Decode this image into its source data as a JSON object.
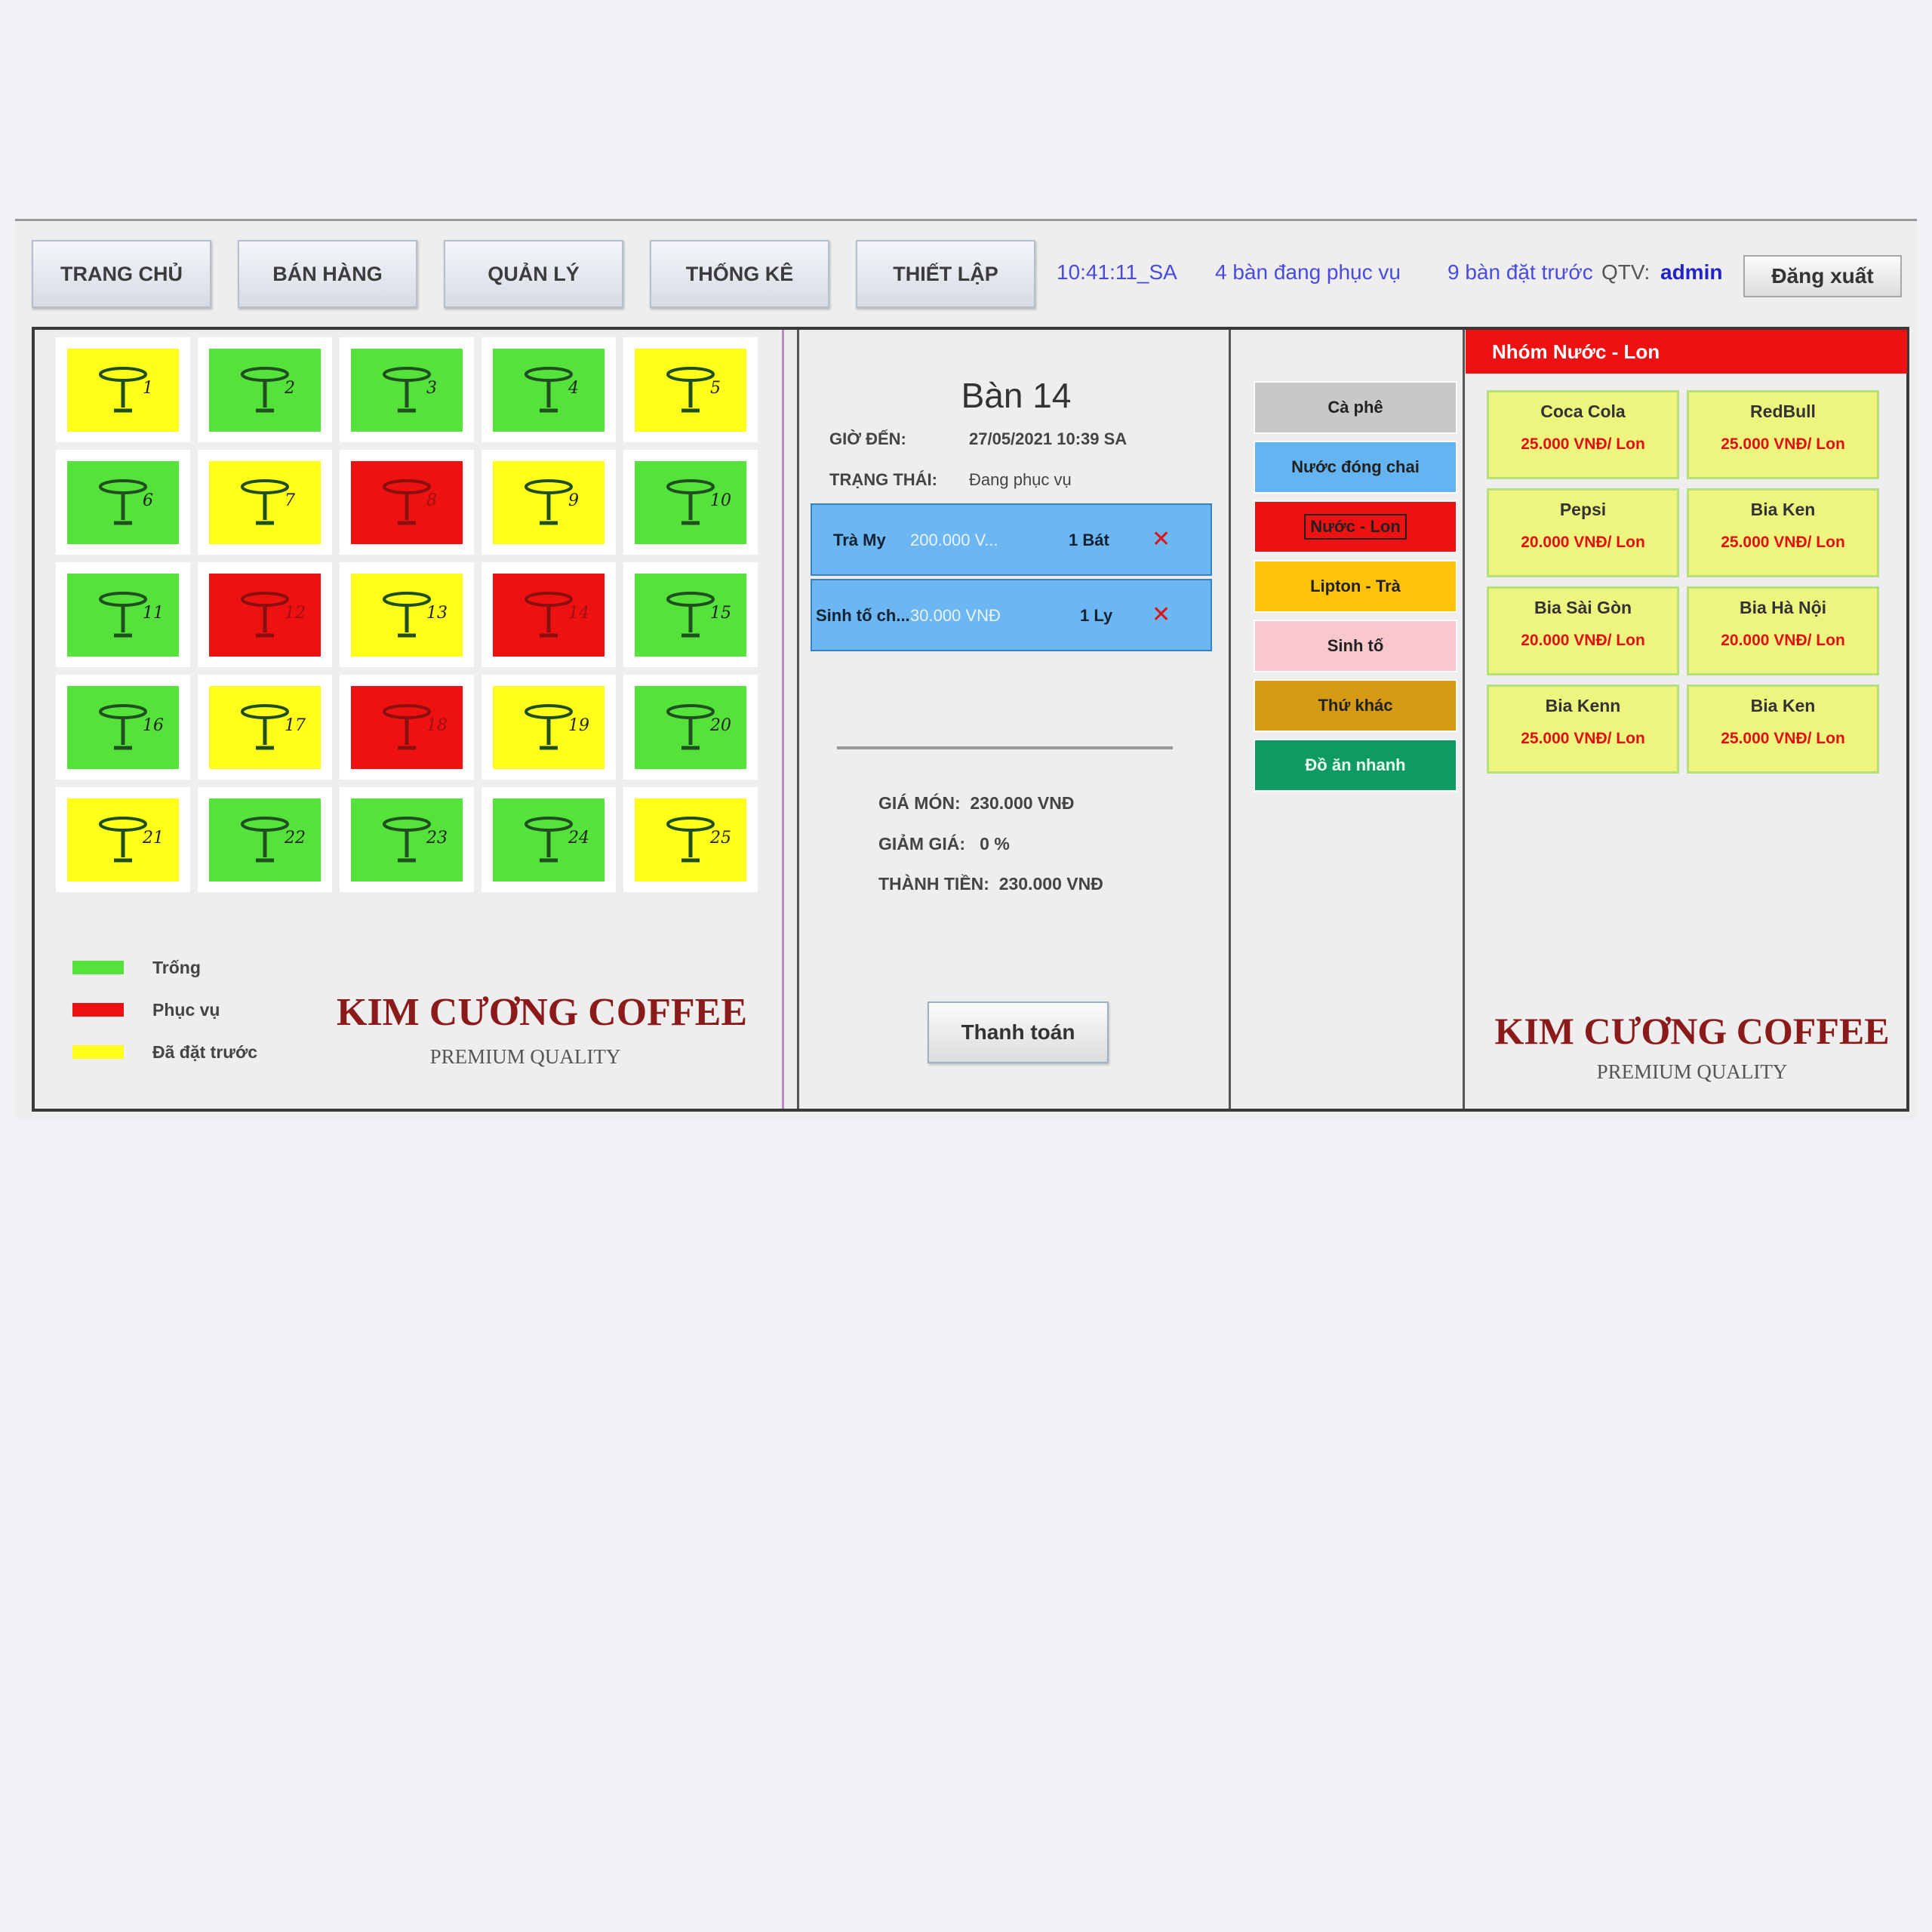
{
  "nav": [
    "TRANG CHỦ",
    "BÁN HÀNG",
    "QUẢN LÝ",
    "THỐNG KÊ",
    "THIẾT LẬP"
  ],
  "status": {
    "time": "10:41:11_SA",
    "serving": "4 bàn đang phục vụ",
    "reserved": "9 bàn đặt trước",
    "admin_label": "QTV:",
    "admin_name": "admin",
    "logout": "Đăng xuất"
  },
  "colors": {
    "empty": "#55e23b",
    "serving": "#ee1111",
    "reserved": "#ffff1a"
  },
  "tables": [
    {
      "num": "1",
      "state": "reserved"
    },
    {
      "num": "2",
      "state": "empty"
    },
    {
      "num": "3",
      "state": "empty"
    },
    {
      "num": "4",
      "state": "empty"
    },
    {
      "num": "5",
      "state": "reserved"
    },
    {
      "num": "6",
      "state": "empty"
    },
    {
      "num": "7",
      "state": "reserved"
    },
    {
      "num": "8",
      "state": "serving"
    },
    {
      "num": "9",
      "state": "reserved"
    },
    {
      "num": "10",
      "state": "empty"
    },
    {
      "num": "11",
      "state": "empty"
    },
    {
      "num": "12",
      "state": "serving"
    },
    {
      "num": "13",
      "state": "reserved"
    },
    {
      "num": "14",
      "state": "serving"
    },
    {
      "num": "15",
      "state": "empty"
    },
    {
      "num": "16",
      "state": "empty"
    },
    {
      "num": "17",
      "state": "reserved"
    },
    {
      "num": "18",
      "state": "serving"
    },
    {
      "num": "19",
      "state": "reserved"
    },
    {
      "num": "20",
      "state": "empty"
    },
    {
      "num": "21",
      "state": "reserved"
    },
    {
      "num": "22",
      "state": "empty"
    },
    {
      "num": "23",
      "state": "empty"
    },
    {
      "num": "24",
      "state": "empty"
    },
    {
      "num": "25",
      "state": "reserved"
    }
  ],
  "legend": {
    "empty": "Trống",
    "serving": "Phục vụ",
    "reserved": "Đã đặt trước"
  },
  "brand": {
    "name": "KIM CƯƠNG COFFEE",
    "sub": "PREMIUM QUALITY"
  },
  "order": {
    "title": "Bàn 14",
    "arrival_label": "GIỜ ĐẾN:",
    "arrival_value": "27/05/2021 10:39 SA",
    "state_label": "TRẠNG THÁI:",
    "state_value": "Đang phục vụ",
    "items": [
      {
        "name": "Trà My",
        "price": "200.000 V...",
        "qty": "1 Bát",
        "del": "✕"
      },
      {
        "name": "Sinh tố ch...",
        "price": "30.000 VNĐ",
        "qty": "1 Ly",
        "del": "✕"
      }
    ],
    "price_label": "GIÁ MÓN:",
    "price_value": "230.000 VNĐ",
    "discount_label": "GIẢM GIÁ:",
    "discount_value": "0 %",
    "total_label": "THÀNH TIỀN:",
    "total_value": "230.000 VNĐ",
    "pay": "Thanh toán"
  },
  "categories": [
    {
      "label": "Cà phê",
      "color": "#c8c8c8"
    },
    {
      "label": "Nước đóng chai",
      "color": "#64b4f2"
    },
    {
      "label": "Nước - Lon",
      "color": "#ee1111",
      "selected": true
    },
    {
      "label": "Lipton - Trà",
      "color": "#ffc20a"
    },
    {
      "label": "Sinh tố",
      "color": "#f8c8cc"
    },
    {
      "label": "Thứ khác",
      "color": "#d49a12"
    },
    {
      "label": "Đồ ăn nhanh",
      "color": "#0f9a62"
    }
  ],
  "products": {
    "header": "Nhóm Nước - Lon",
    "items": [
      {
        "name": "Coca Cola",
        "price": "25.000 VNĐ/ Lon"
      },
      {
        "name": "RedBull",
        "price": "25.000 VNĐ/ Lon"
      },
      {
        "name": "Pepsi",
        "price": "20.000 VNĐ/ Lon"
      },
      {
        "name": "Bia Ken",
        "price": "25.000 VNĐ/ Lon"
      },
      {
        "name": "Bia Sài Gòn",
        "price": "20.000 VNĐ/ Lon"
      },
      {
        "name": "Bia Hà Nội",
        "price": "20.000 VNĐ/ Lon"
      },
      {
        "name": "Bia Kenn",
        "price": "25.000 VNĐ/ Lon"
      },
      {
        "name": "Bia Ken",
        "price": "25.000 VNĐ/ Lon"
      }
    ]
  }
}
